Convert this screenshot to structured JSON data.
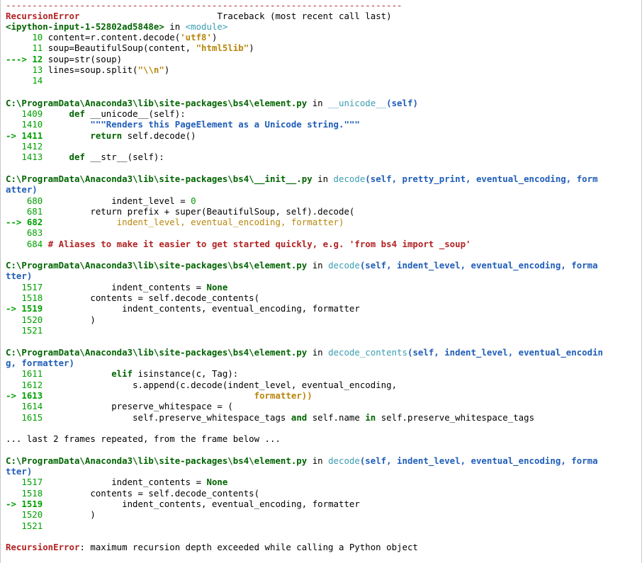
{
  "traceback": {
    "dash_line": "---------------------------------------------------------------------------",
    "error_name": "RecursionError",
    "header_right": "Traceback (most recent call last)",
    "module_file": "<ipython-input-1-52802ad5848e>",
    "in_word": "in",
    "module_name": "<module>",
    "frame1": {
      "l10_no": "10",
      "l10_a": "content=r.content.decode(",
      "l10_str": "'utf8'",
      "l10_b": ")",
      "l11_no": "11",
      "l11_a": "soup=BeautifulSoup(content, ",
      "l11_str": "\"html5lib\"",
      "l11_b": ")",
      "l12_arrow": "--->",
      "l12_no": "12",
      "l12_text": "soup=str(soup)",
      "l13_no": "13",
      "l13_a": "lines=soup.split(",
      "l13_str": "\"\\\\n\"",
      "l13_b": ")",
      "l14_no": "14"
    },
    "frame2": {
      "path": "C:\\ProgramData\\Anaconda3\\lib\\site-packages\\bs4\\element.py",
      "func": "__unicode__",
      "args": "(self)",
      "l1409_no": "1409",
      "l1409_kw": "def",
      "l1409_text": "__unicode__(self):",
      "l1410_no": "1410",
      "l1410_text": "\"\"\"Renders this PageElement as a Unicode string.\"\"\"",
      "l1411_arrow": "->",
      "l1411_no": "1411",
      "l1411_kw": "return",
      "l1411_text": "self.decode()",
      "l1412_no": "1412",
      "l1413_no": "1413",
      "l1413_kw": "def",
      "l1413_text": "__str__(self):"
    },
    "frame3": {
      "path": "C:\\ProgramData\\Anaconda3\\lib\\site-packages\\bs4\\__init__.py",
      "func": "decode",
      "args_a": "(self, pretty_print, eventual_encoding, form",
      "args_b": "atter)",
      "l680_no": "680",
      "l680_text": "indent_level = ",
      "l680_val": "0",
      "l681_no": "681",
      "l681_text": "return prefix + super(BeautifulSoup, self).decode(",
      "l682_arrow": "-->",
      "l682_no": "682",
      "l682_text": "indent_level, eventual_encoding, formatter)",
      "l683_no": "683",
      "l684_no": "684",
      "l684_text": "# Aliases to make it easier to get started quickly, e.g. 'from bs4 import _soup'"
    },
    "frame4": {
      "path": "C:\\ProgramData\\Anaconda3\\lib\\site-packages\\bs4\\element.py",
      "func": "decode",
      "args_a": "(self, indent_level, eventual_encoding, forma",
      "args_b": "tter)",
      "l1517_no": "1517",
      "l1517_text": "indent_contents = ",
      "l1517_val": "None",
      "l1518_no": "1518",
      "l1518_text": "contents = self.decode_contents(",
      "l1519_arrow": "->",
      "l1519_no": "1519",
      "l1519_text": "indent_contents, eventual_encoding, formatter",
      "l1520_no": "1520",
      "l1520_text": ")",
      "l1521_no": "1521"
    },
    "frame5": {
      "path": "C:\\ProgramData\\Anaconda3\\lib\\site-packages\\bs4\\element.py",
      "func": "decode_contents",
      "args_a": "(self, indent_level, eventual_encodin",
      "args_b": "g, formatter)",
      "l1611_no": "1611",
      "l1611_kw": "elif",
      "l1611_text": "isinstance(c, Tag):",
      "l1612_no": "1612",
      "l1612_text": "s.append(c.decode(indent_level, eventual_encoding,",
      "l1613_arrow": "->",
      "l1613_no": "1613",
      "l1613_text": "formatter))",
      "l1614_no": "1614",
      "l1614_text": "preserve_whitespace = (",
      "l1615_no": "1615",
      "l1615_a": "self.preserve_whitespace_tags ",
      "l1615_and": "and",
      "l1615_b": " self.name ",
      "l1615_in": "in",
      "l1615_c": " self.preserve_whitespace_tags"
    },
    "repeat_note": "... last 2 frames repeated, from the frame below ...",
    "frame6": {
      "path": "C:\\ProgramData\\Anaconda3\\lib\\site-packages\\bs4\\element.py",
      "func": "decode",
      "args_a": "(self, indent_level, eventual_encoding, forma",
      "args_b": "tter)",
      "l1517_no": "1517",
      "l1517_text": "indent_contents = ",
      "l1517_val": "None",
      "l1518_no": "1518",
      "l1518_text": "contents = self.decode_contents(",
      "l1519_arrow": "->",
      "l1519_no": "1519",
      "l1519_text": "indent_contents, eventual_encoding, formatter",
      "l1520_no": "1520",
      "l1520_text": ")",
      "l1521_no": "1521"
    },
    "final": {
      "error_name": "RecursionError",
      "message": ": maximum recursion depth exceeded while calling a Python object"
    }
  }
}
